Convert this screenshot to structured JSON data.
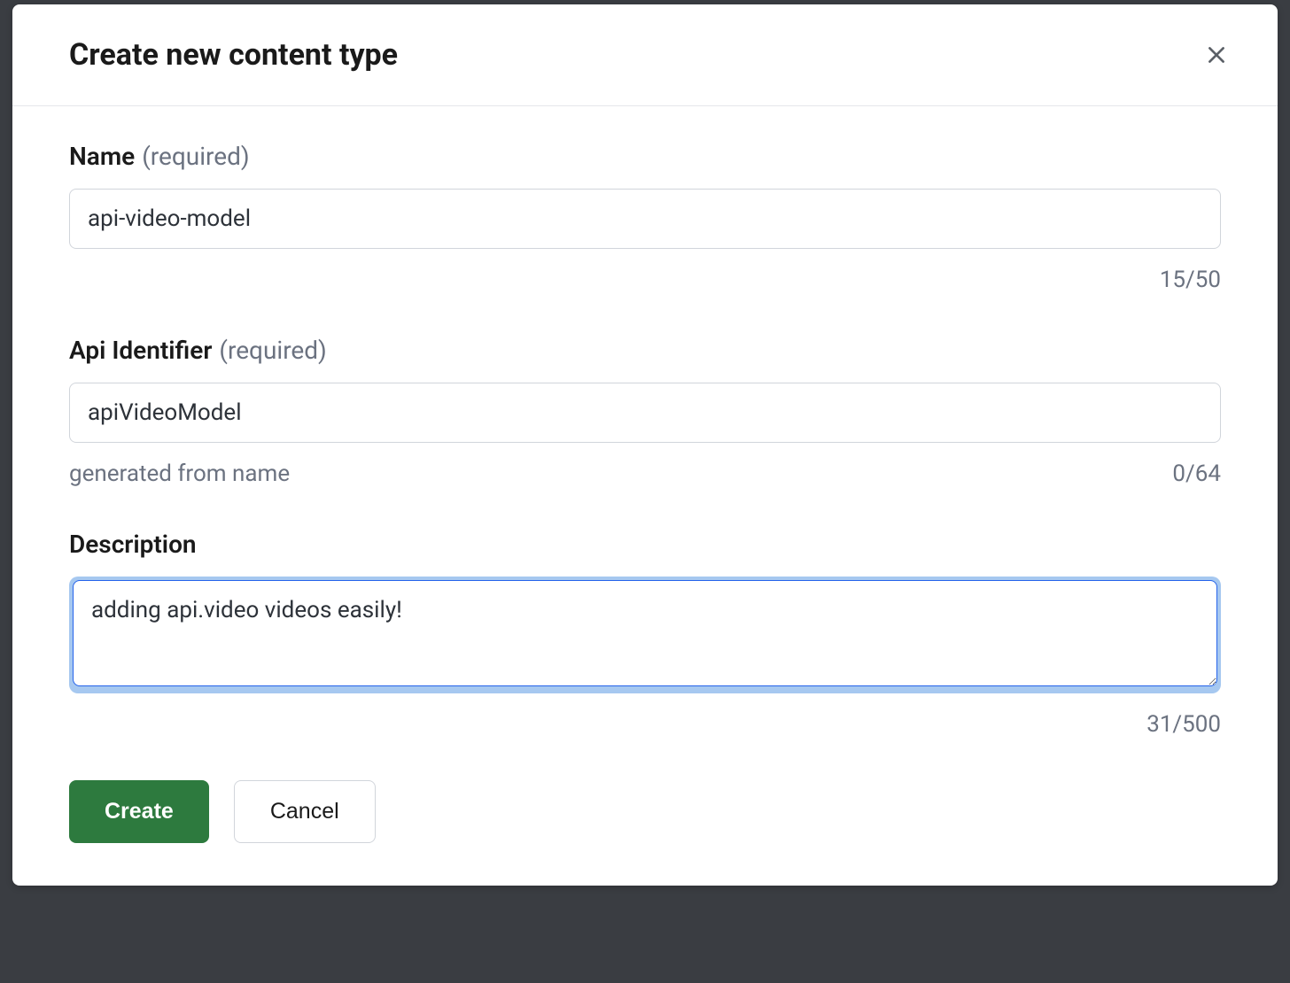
{
  "modal": {
    "title": "Create new content type",
    "fields": {
      "name": {
        "label": "Name",
        "required_hint": "(required)",
        "value": "api-video-model",
        "counter": "15/50"
      },
      "apiIdentifier": {
        "label": "Api Identifier",
        "required_hint": "(required)",
        "value": "apiVideoModel",
        "helper": "generated from name",
        "counter": "0/64"
      },
      "description": {
        "label": "Description",
        "value": "adding api.video videos easily!",
        "counter": "31/500"
      }
    },
    "buttons": {
      "create": "Create",
      "cancel": "Cancel"
    }
  }
}
